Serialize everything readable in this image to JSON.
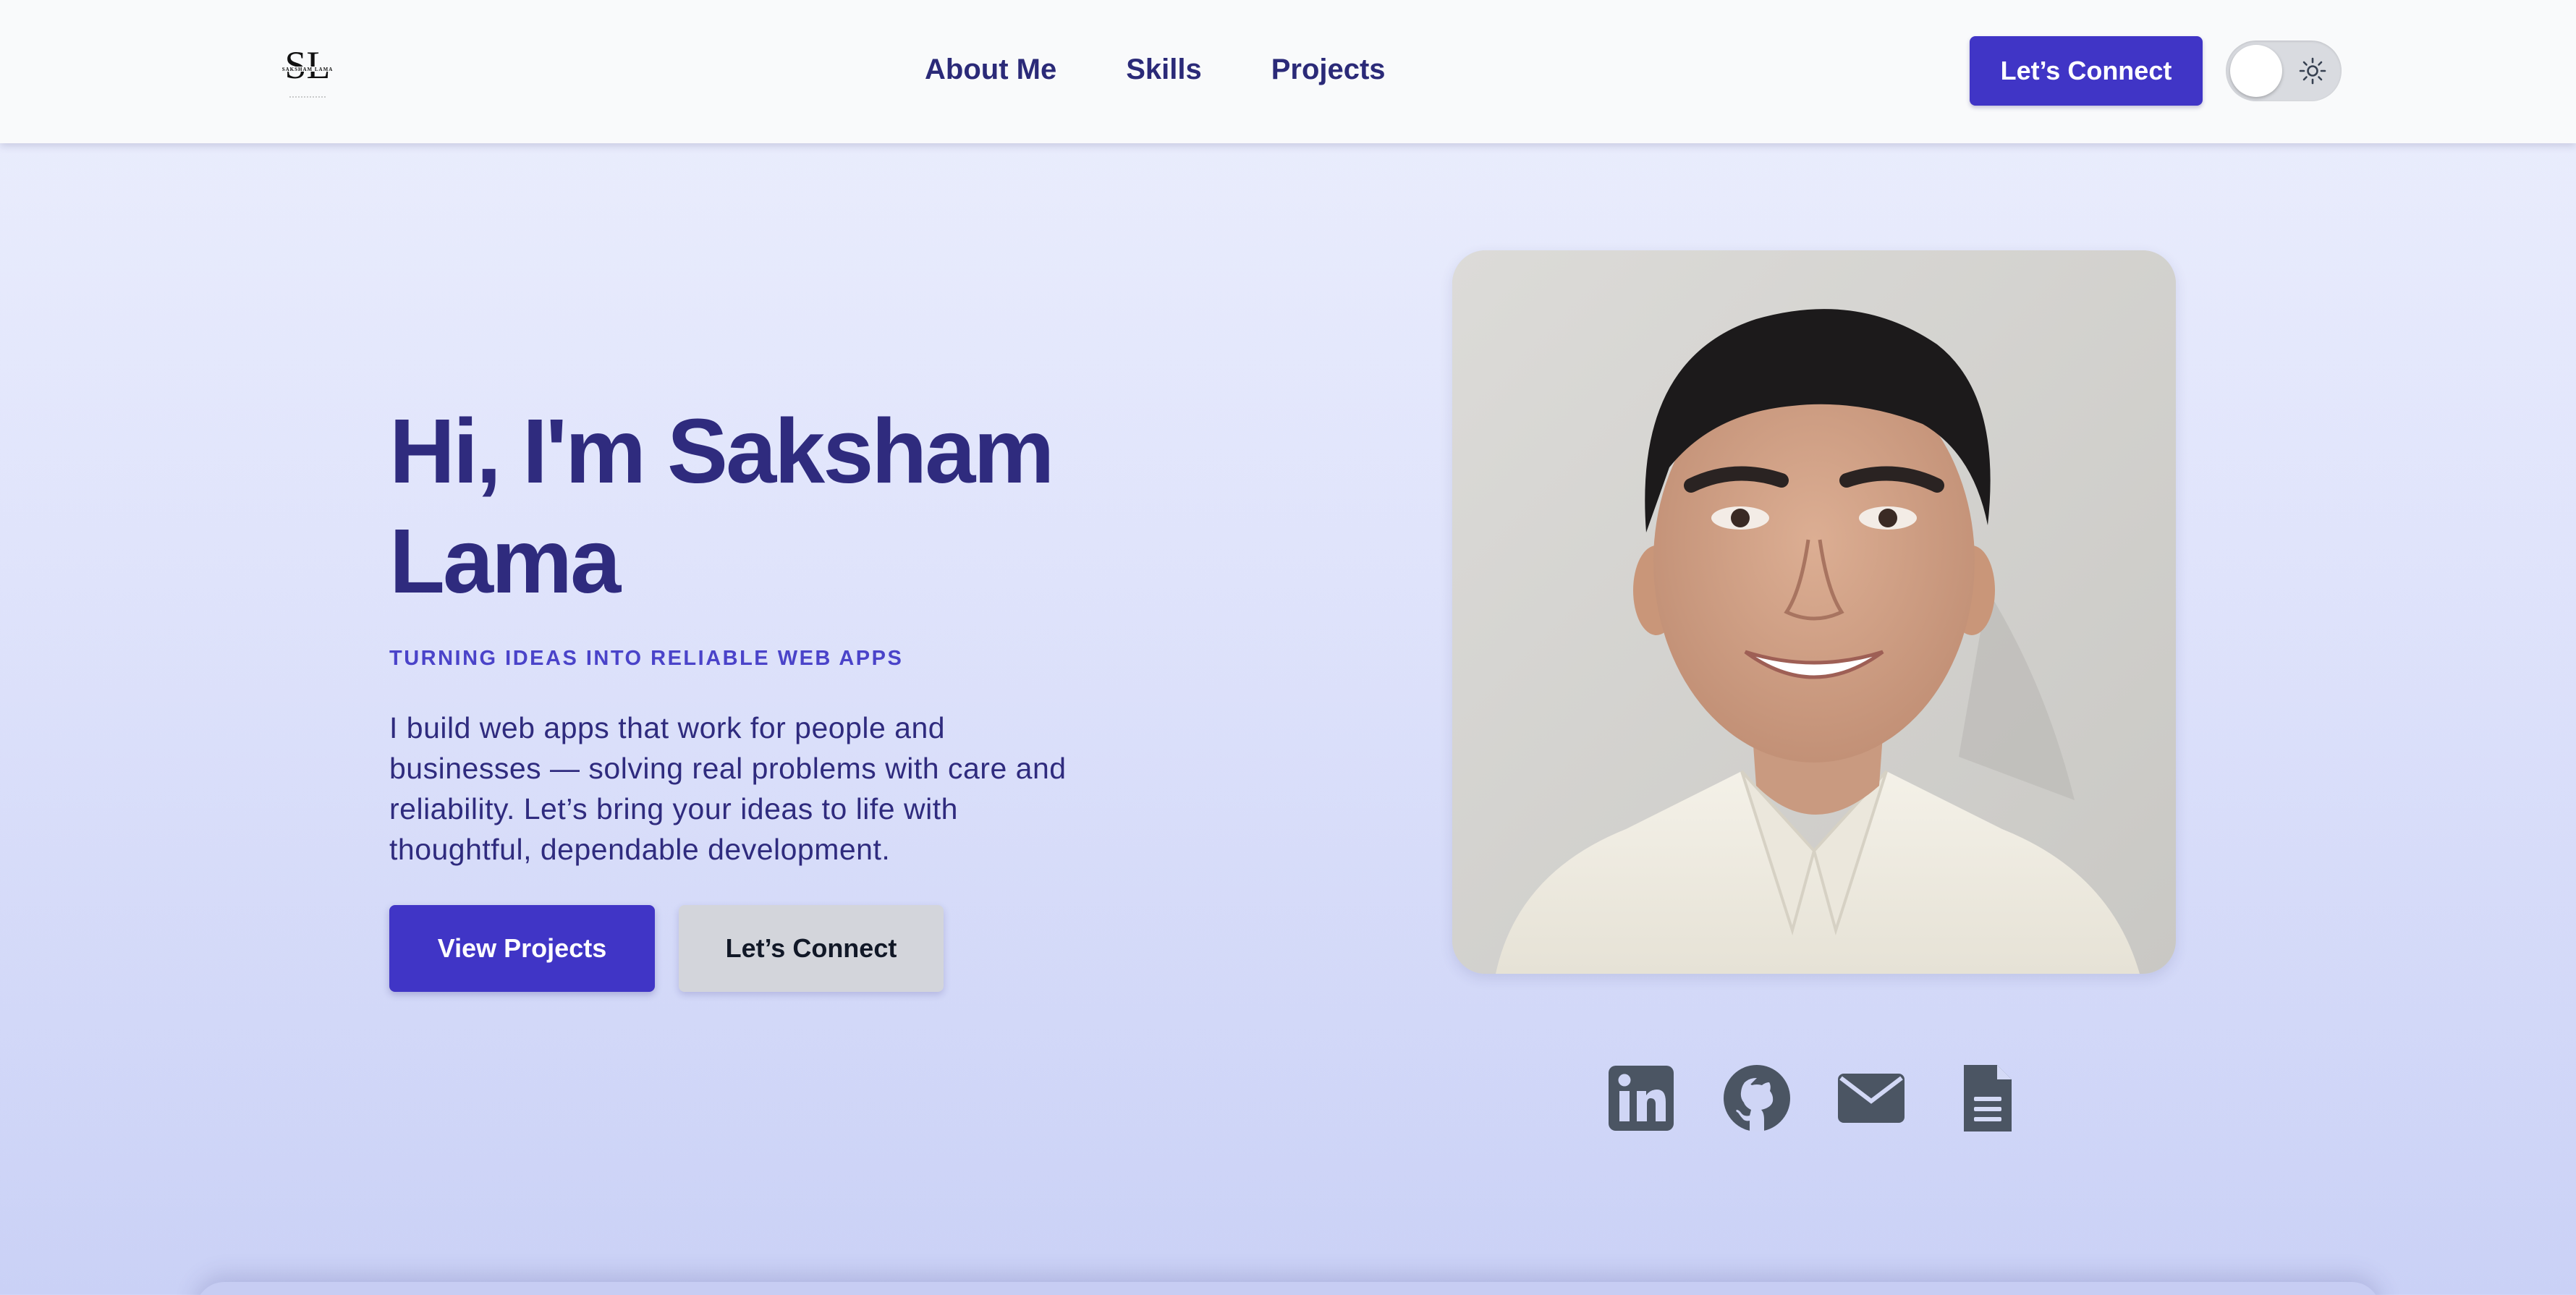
{
  "header": {
    "logo_monogram": "SL",
    "logo_name": "SAKSHAM LAMA",
    "nav": [
      {
        "label": "About Me"
      },
      {
        "label": "Skills"
      },
      {
        "label": "Projects"
      }
    ],
    "cta_label": "Let’s Connect",
    "theme_toggle_icon": "sun-icon"
  },
  "hero": {
    "title": "Hi, I'm Saksham Lama",
    "tagline": "TURNING IDEAS INTO RELIABLE WEB APPS",
    "description": "I build web apps that work for people and businesses — solving real problems with care and reliability. Let’s bring your ideas to life with thoughtful, dependable development.",
    "primary_button": "View Projects",
    "secondary_button": "Let’s Connect"
  },
  "social": [
    {
      "icon": "linkedin-icon"
    },
    {
      "icon": "github-icon"
    },
    {
      "icon": "email-icon"
    },
    {
      "icon": "document-icon"
    }
  ],
  "colors": {
    "accent": "#4035c6",
    "heading": "#2f2b7e",
    "tagline": "#4a43c9",
    "icon": "#4b5563",
    "nav_bg": "#f9fafb"
  }
}
